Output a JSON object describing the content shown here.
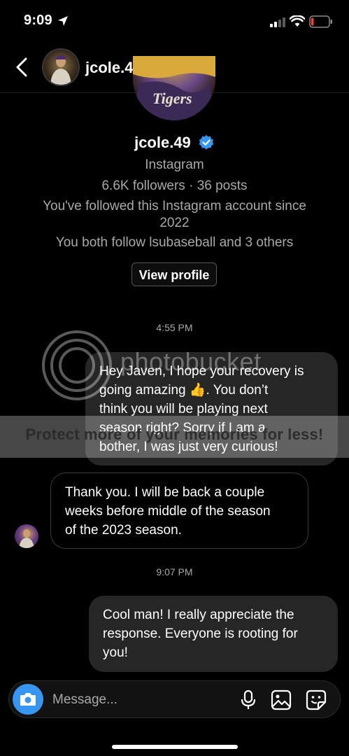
{
  "status_bar": {
    "time": "9:09"
  },
  "header": {
    "username": "jcole.49"
  },
  "profile": {
    "username": "jcole.49",
    "platform": "Instagram",
    "stats": "6.6K followers · 36 posts",
    "followed_since_line1": "You've followed this Instagram account since",
    "followed_since_line2": "2022",
    "mutual": "You both follow lsubaseball and 3 others",
    "view_profile_label": "View profile"
  },
  "messages": {
    "timestamp_1": "4:55 PM",
    "sent_1": [
      "Hey Javen,  I hope your recovery is",
      "going amazing 👍.  You don’t",
      "think you will be playing next",
      "season right?  Sorry if I am a",
      "bother, I was just very curious!"
    ],
    "received_1": [
      "Thank you. I will be back a couple",
      "weeks before middle of the season",
      "of the 2023 season."
    ],
    "timestamp_2": "9:07 PM",
    "sent_2": [
      "Cool man!  I really appreciate the",
      "response.  Everyone is rooting for",
      "you!"
    ]
  },
  "watermark": {
    "brand": "photobucket",
    "banner": "Protect more of your memories for less!"
  },
  "composer": {
    "placeholder": "Message..."
  },
  "icons": {
    "back": "chevron-left-icon",
    "verified": "verified-badge-icon",
    "camera": "camera-icon",
    "mic": "microphone-icon",
    "gallery": "image-icon",
    "sticker": "sticker-icon"
  },
  "colors": {
    "background": "#000000",
    "sent_bubble": "#262626",
    "accent_blue": "#3797f0",
    "secondary_text": "#a8a8a8"
  }
}
